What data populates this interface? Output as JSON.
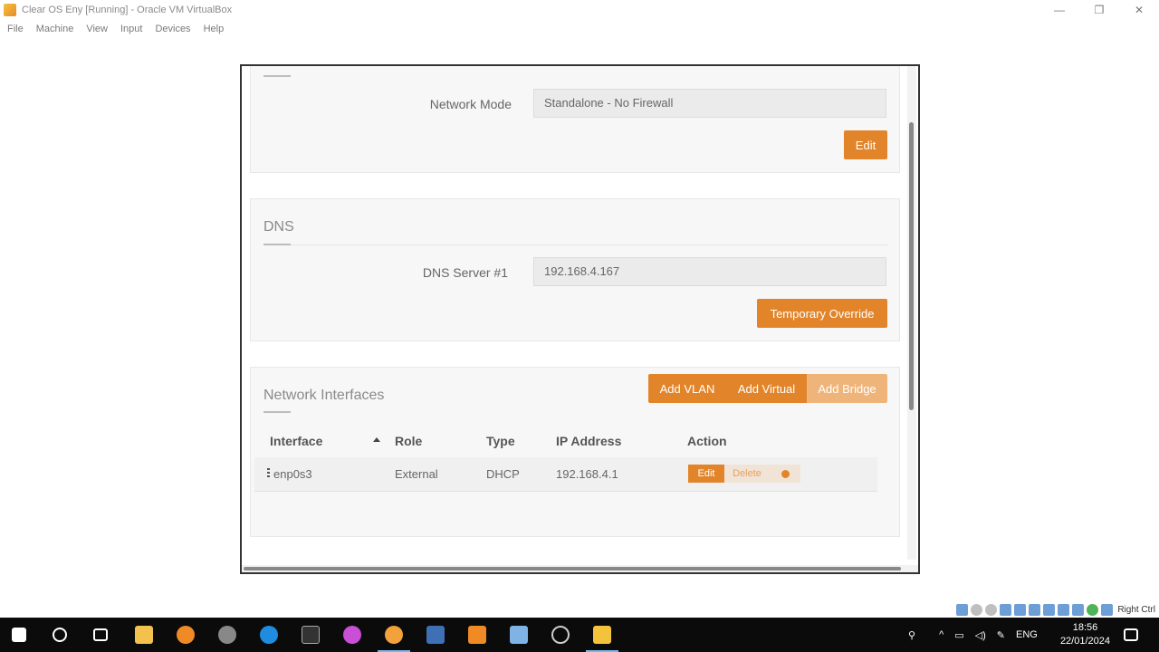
{
  "window": {
    "title": "Clear OS Eny [Running] - Oracle VM VirtualBox",
    "controls": [
      "—",
      "❐",
      "✕"
    ]
  },
  "menubar": [
    "File",
    "Machine",
    "View",
    "Input",
    "Devices",
    "Help"
  ],
  "network_section": {
    "mode_label": "Network Mode",
    "mode_value": "Standalone - No Firewall",
    "edit_button": "Edit"
  },
  "dns_section": {
    "title": "DNS",
    "server_label": "DNS Server #1",
    "server_value": "192.168.4.167",
    "override_button": "Temporary Override"
  },
  "interfaces_section": {
    "title": "Network Interfaces",
    "buttons": {
      "add_vlan": "Add VLAN",
      "add_virtual": "Add Virtual",
      "add_bridge": "Add Bridge"
    },
    "columns": [
      "Interface",
      "Role",
      "Type",
      "IP Address",
      "Action"
    ],
    "rows": [
      {
        "interface": "enp0s3",
        "role": "External",
        "type": "DHCP",
        "ip": "192.168.4.1",
        "actions": {
          "edit": "Edit",
          "delete": "Delete"
        }
      }
    ]
  },
  "vbox_status": {
    "host_key": "Right Ctrl"
  },
  "taskbar": {
    "language": "ENG",
    "time": "18:56",
    "date": "22/01/2024"
  },
  "colors": {
    "accent": "#e2852a",
    "accent_light": "#efb47a",
    "panel_bg": "#f7f7f7",
    "taskbar_bg": "#0b0b0b"
  }
}
